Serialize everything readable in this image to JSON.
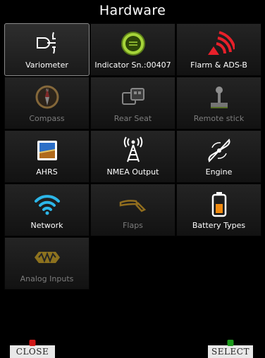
{
  "title": "Hardware",
  "tiles": [
    {
      "label": "Variometer",
      "icon": "vario-icon",
      "state": "selected"
    },
    {
      "label": "Indicator Sn.:00407",
      "icon": "indicator-icon",
      "state": "normal"
    },
    {
      "label": "Flarm & ADS-B",
      "icon": "flarm-icon",
      "state": "normal"
    },
    {
      "label": "Compass",
      "icon": "compass-icon",
      "state": "disabled"
    },
    {
      "label": "Rear Seat",
      "icon": "rear-seat-icon",
      "state": "disabled"
    },
    {
      "label": "Remote stick",
      "icon": "joystick-icon",
      "state": "disabled"
    },
    {
      "label": "AHRS",
      "icon": "ahrs-icon",
      "state": "normal"
    },
    {
      "label": "NMEA Output",
      "icon": "antenna-icon",
      "state": "normal"
    },
    {
      "label": "Engine",
      "icon": "propeller-icon",
      "state": "normal"
    },
    {
      "label": "Network",
      "icon": "wifi-icon",
      "state": "normal"
    },
    {
      "label": "Flaps",
      "icon": "flaps-icon",
      "state": "disabled"
    },
    {
      "label": "Battery Types",
      "icon": "battery-icon",
      "state": "normal"
    },
    {
      "label": "Analog Inputs",
      "icon": "analog-icon",
      "state": "disabled"
    }
  ],
  "footer": {
    "close_label": "CLOSE",
    "select_label": "SELECT"
  },
  "colors": {
    "background": "#000000",
    "tile": "#1e1e1e",
    "accent_green": "#9acd32",
    "flarm_red": "#e8202a",
    "disabled_text": "#7d7d7d"
  }
}
